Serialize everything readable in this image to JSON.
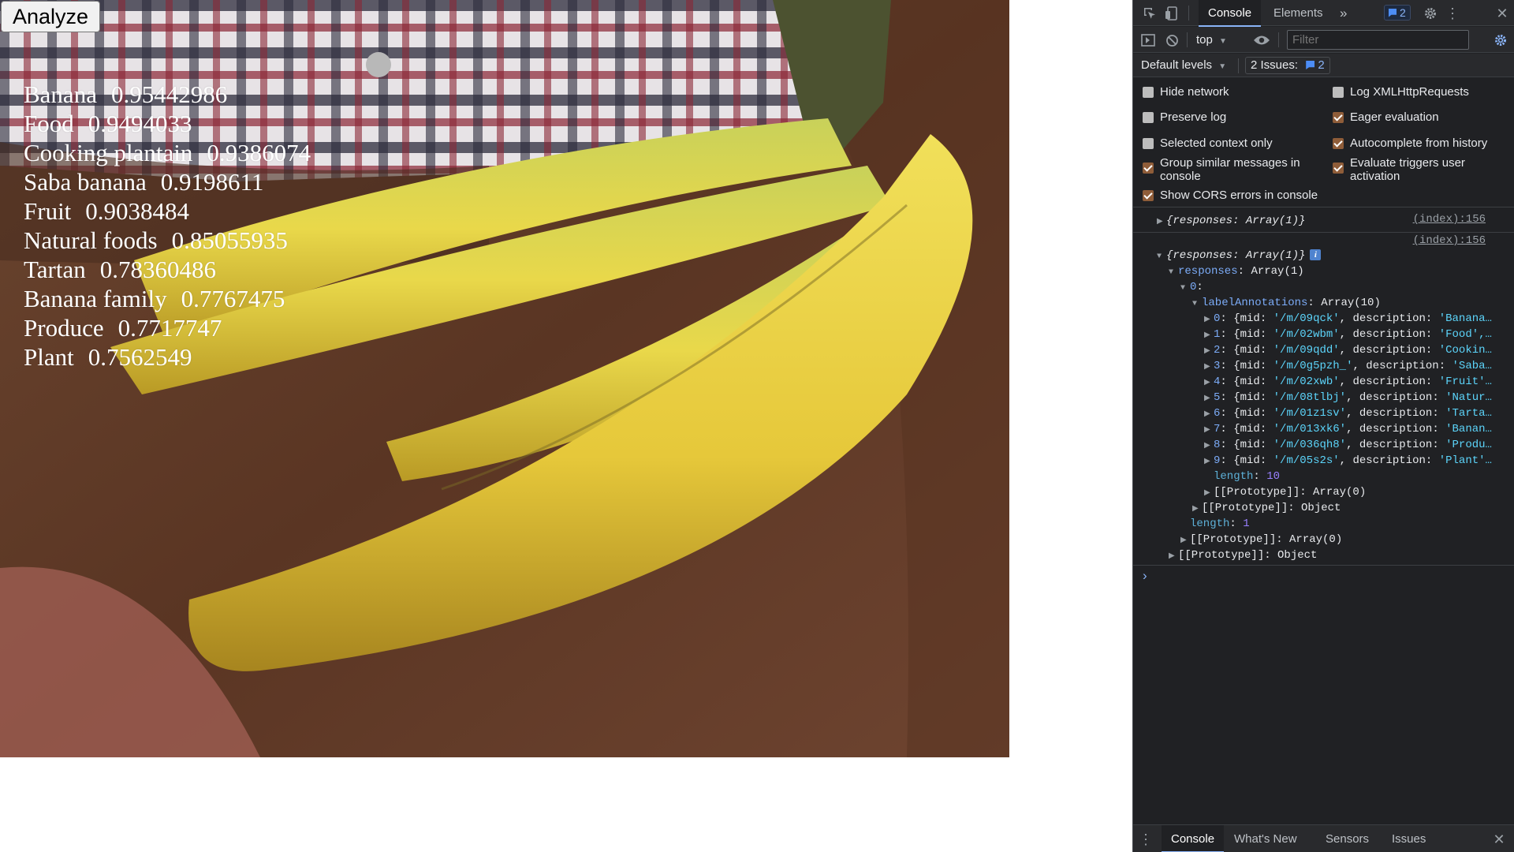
{
  "page": {
    "analyze_label": "Analyze",
    "labels": [
      {
        "name": "Banana",
        "score": "0.95442986"
      },
      {
        "name": "Food",
        "score": "0.9494033"
      },
      {
        "name": "Cooking plantain",
        "score": "0.9386074"
      },
      {
        "name": "Saba banana",
        "score": "0.9198611"
      },
      {
        "name": "Fruit",
        "score": "0.9038484"
      },
      {
        "name": "Natural foods",
        "score": "0.85055935"
      },
      {
        "name": "Tartan",
        "score": "0.78360486"
      },
      {
        "name": "Banana family",
        "score": "0.7767475"
      },
      {
        "name": "Produce",
        "score": "0.7717747"
      },
      {
        "name": "Plant",
        "score": "0.7562549"
      }
    ]
  },
  "devtools": {
    "tabs": {
      "console": "Console",
      "elements": "Elements",
      "more": "»",
      "issues_count": "2"
    },
    "toolbar": {
      "context": "top",
      "filter_placeholder": "Filter"
    },
    "levels": {
      "label": "Default levels",
      "issues_label": "2 Issues:",
      "issues_count": "2"
    },
    "settings": {
      "hide_network": "Hide network",
      "log_xhr": "Log XMLHttpRequests",
      "preserve_log": "Preserve log",
      "eager_eval": "Eager evaluation",
      "selected_context": "Selected context only",
      "autocomplete": "Autocomplete from history",
      "group_similar": "Group similar messages in console",
      "eval_triggers": "Evaluate triggers user activation",
      "show_cors": "Show CORS errors in console"
    },
    "console": {
      "source": "(index):156",
      "collapsed_obj": "{responses: Array(1)}",
      "expanded_obj": "{responses: Array(1)}",
      "responses_key": "responses",
      "responses_val": "Array(1)",
      "index0": "0",
      "label_annotations_key": "labelAnnotations",
      "label_annotations_val": "Array(10)",
      "entries": [
        {
          "idx": "0",
          "mid": "'/m/09qck'",
          "desc": "'Banana…"
        },
        {
          "idx": "1",
          "mid": "'/m/02wbm'",
          "desc": "'Food',…"
        },
        {
          "idx": "2",
          "mid": "'/m/09qdd'",
          "desc": "'Cookin…"
        },
        {
          "idx": "3",
          "mid": "'/m/0g5pzh_'",
          "desc": "'Saba…"
        },
        {
          "idx": "4",
          "mid": "'/m/02xwb'",
          "desc": "'Fruit'…"
        },
        {
          "idx": "5",
          "mid": "'/m/08tlbj'",
          "desc": "'Natur…"
        },
        {
          "idx": "6",
          "mid": "'/m/01z1sv'",
          "desc": "'Tarta…"
        },
        {
          "idx": "7",
          "mid": "'/m/013xk6'",
          "desc": "'Banan…"
        },
        {
          "idx": "8",
          "mid": "'/m/036qh8'",
          "desc": "'Produ…"
        },
        {
          "idx": "9",
          "mid": "'/m/05s2s'",
          "desc": "'Plant'…"
        }
      ],
      "length_key": "length",
      "length10": "10",
      "length1": "1",
      "proto_array": "[[Prototype]]: Array(0)",
      "proto_object": "[[Prototype]]: Object",
      "prompt": "›"
    },
    "drawer": {
      "console": "Console",
      "whats_new": "What's New",
      "sensors": "Sensors",
      "issues": "Issues"
    }
  }
}
